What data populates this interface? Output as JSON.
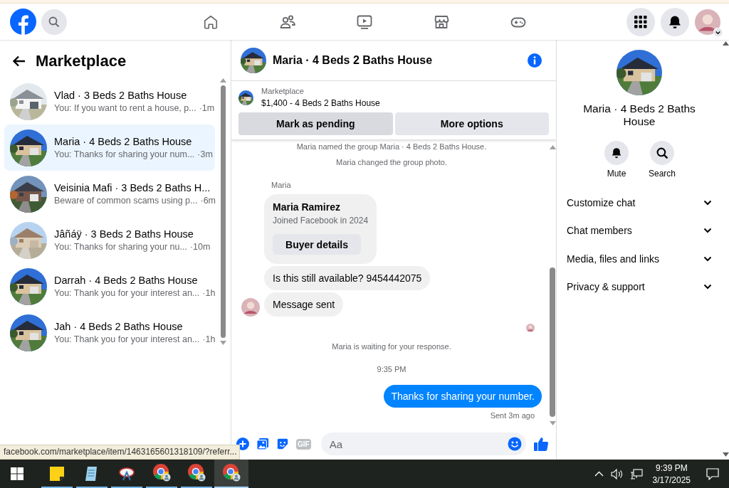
{
  "sidebar": {
    "title": "Marketplace",
    "conversations": [
      {
        "title": "Vlad · 3 Beds 2 Baths House",
        "preview": "You: If you want to rent a house, p...",
        "time": "·1m",
        "selected": false
      },
      {
        "title": "Maria · 4 Beds 2 Baths House",
        "preview": "You: Thanks for sharing your num...",
        "time": "·3m",
        "selected": true
      },
      {
        "title": "Veisinia Mafi · 3 Beds 2 Baths H...",
        "preview": "Beware of common scams using p...",
        "time": "·6m",
        "selected": false
      },
      {
        "title": "Jâñáÿ · 3 Beds 2 Baths House",
        "preview": "You: Thanks for sharing your nu...",
        "time": "·10m",
        "selected": false
      },
      {
        "title": "Darrah · 4 Beds 2 Baths House",
        "preview": "You: Thank you for your interest an...",
        "time": "·1h",
        "selected": false
      },
      {
        "title": "Jah · 4 Beds 2 Baths House",
        "preview": "You: Thank you for your interest an...",
        "time": "·1h",
        "selected": false
      }
    ]
  },
  "chat": {
    "title": "Maria · 4 Beds 2 Baths House",
    "listing": {
      "label": "Marketplace",
      "title": "$1,400 - 4 Beds 2 Baths House"
    },
    "actions": [
      "Mark as pending",
      "More options"
    ],
    "messages": [
      {
        "kind": "event",
        "text": "Maria named the group Maria · 4 Beds 2 Baths House."
      },
      {
        "kind": "event",
        "text": "Maria changed the group photo."
      },
      {
        "kind": "sender",
        "text": "Maria"
      },
      {
        "kind": "card",
        "name": "Maria Ramirez",
        "subtitle": "Joined Facebook in 2024",
        "button": "Buyer details"
      },
      {
        "kind": "incoming",
        "text": "Is this still available? 9454442075"
      },
      {
        "kind": "incoming",
        "text": "Message sent",
        "avatar": true
      },
      {
        "kind": "seen"
      },
      {
        "kind": "event",
        "text": "Maria is waiting for your response."
      },
      {
        "kind": "time",
        "text": "9:35 PM"
      },
      {
        "kind": "outgoing",
        "text": "Thanks for sharing your number."
      },
      {
        "kind": "status",
        "text": "Sent 3m ago"
      }
    ],
    "composer": {
      "gif": "GIF",
      "placeholder": "Aa"
    }
  },
  "details": {
    "title": "Maria · 4 Beds 2 Baths House",
    "actions": [
      {
        "kind": "mute",
        "label": "Mute"
      },
      {
        "kind": "search",
        "label": "Search"
      }
    ],
    "sections": [
      {
        "label": "Customize chat",
        "expanded": false
      },
      {
        "label": "Chat members",
        "expanded": false
      },
      {
        "label": "Media, files and links",
        "expanded": false
      },
      {
        "label": "Privacy & support",
        "expanded": false
      }
    ]
  },
  "status_url": "facebook.com/marketplace/item/1463165601318109/?referr...",
  "taskbar": {
    "apps": [
      {
        "kind": "sticky-notes",
        "selected": false
      },
      {
        "kind": "notepad",
        "selected": false
      },
      {
        "kind": "snipping",
        "selected": false
      },
      {
        "kind": "chrome",
        "selected": false
      },
      {
        "kind": "chrome",
        "selected": false
      },
      {
        "kind": "chrome",
        "selected": true
      }
    ],
    "time": "9:39 PM",
    "date": "3/17/2025"
  }
}
